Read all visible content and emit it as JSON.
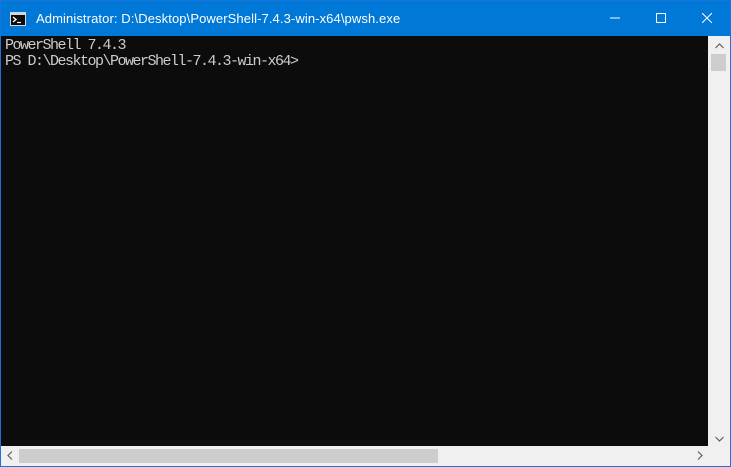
{
  "window": {
    "title": "Administrator: D:\\Desktop\\PowerShell-7.4.3-win-x64\\pwsh.exe",
    "titlebar_color": "#0078d7",
    "app_icon": "powershell-icon",
    "buttons": {
      "minimize_icon": "minimize-icon",
      "maximize_icon": "maximize-icon",
      "close_icon": "close-icon"
    }
  },
  "console": {
    "background": "#0c0c0c",
    "foreground": "#cccccc",
    "lines": [
      "PowerShell 7.4.3",
      "PS D:\\Desktop\\PowerShell-7.4.3-win-x64>"
    ]
  },
  "scrollbars": {
    "vertical": {
      "up_icon": "chevron-up-icon",
      "down_icon": "chevron-down-icon"
    },
    "horizontal": {
      "left_icon": "chevron-left-icon",
      "right_icon": "chevron-right-icon"
    }
  }
}
